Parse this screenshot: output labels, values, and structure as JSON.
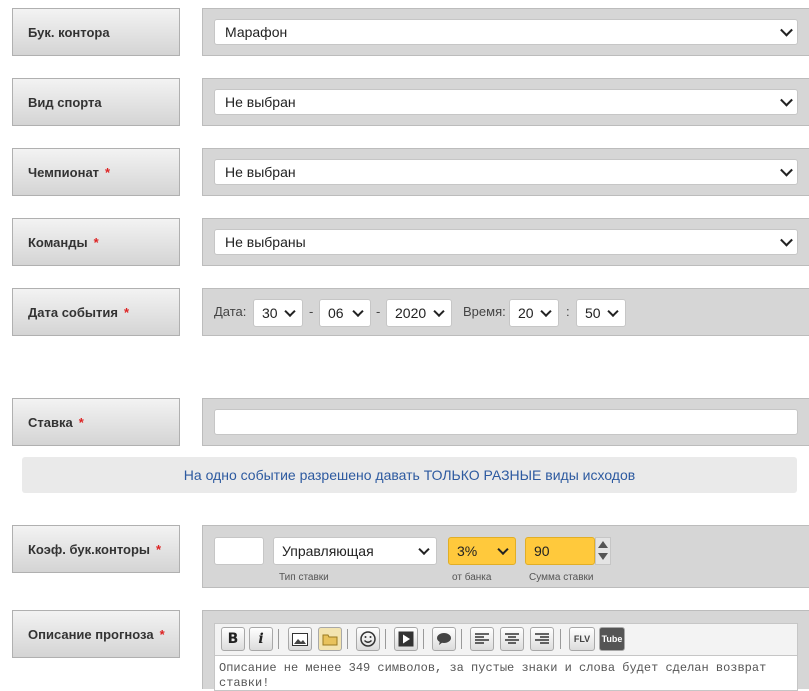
{
  "form": {
    "bookmaker": {
      "label": "Бук. контора",
      "value": "Марафон"
    },
    "sport": {
      "label": "Вид спорта",
      "value": "Не выбран"
    },
    "championship": {
      "label": "Чемпионат",
      "required": "*",
      "value": "Не выбран"
    },
    "teams": {
      "label": "Команды",
      "required": "*",
      "value": "Не выбраны"
    },
    "event_date": {
      "label": "Дата события",
      "required": "*",
      "date_label": "Дата:",
      "day": "30",
      "month": "06",
      "year": "2020",
      "dash": "-",
      "time_label": "Время:",
      "hour": "20",
      "minute": "50",
      "colon": ":"
    },
    "bet": {
      "label": "Ставка",
      "required": "*",
      "value": ""
    },
    "notice": "На одно событие разрешено давать ТОЛЬКО РАЗНЫЕ виды исходов",
    "coef": {
      "label": "Коэф. бук.конторы",
      "required": "*",
      "value": "",
      "bet_type": "Управляющая",
      "bet_type_caption": "Тип ставки",
      "bank_percent": "3%",
      "bank_caption": "от банка",
      "amount": "90",
      "amount_caption": "Сумма ставки"
    },
    "description": {
      "label": "Описание прогноза",
      "required": "*",
      "toolbar": [
        "bold",
        "italic",
        "image",
        "folder",
        "smiley",
        "video",
        "comment",
        "align-left",
        "align-center",
        "align-right",
        "flv",
        "youtube"
      ],
      "bold_glyph": "B",
      "italic_glyph": "i",
      "flv_text": "FLV",
      "tube_text": "Tube",
      "text": "Описание не менее 349 символов, за пустые знаки и слова будет сделан возврат ставки!"
    }
  },
  "colors": {
    "accent_yellow": "#ffc93c",
    "required_red": "#dd2222",
    "notice_blue": "#2d5aa0"
  }
}
